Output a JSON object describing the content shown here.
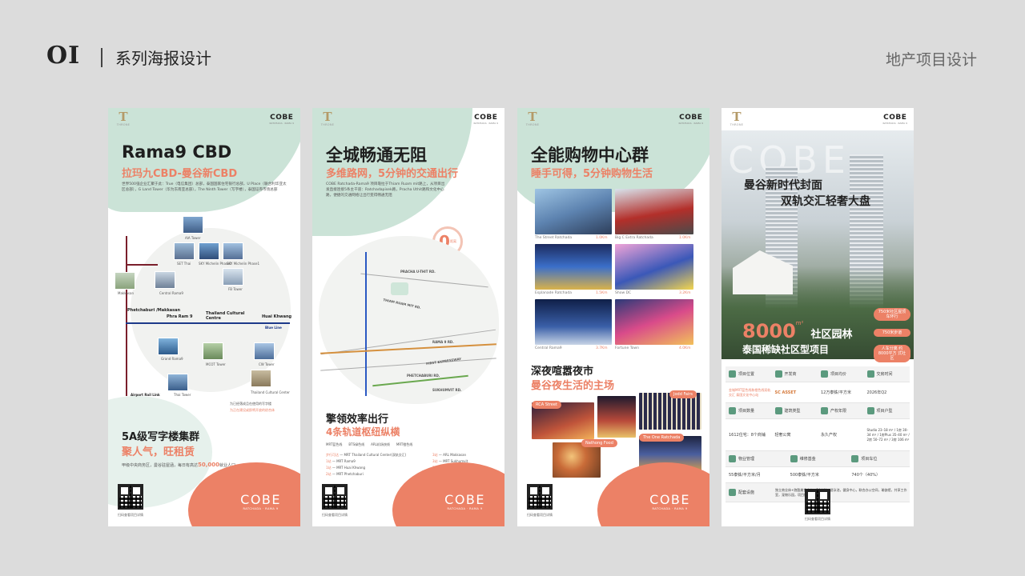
{
  "header": {
    "number": "OI",
    "title": "系列海报设计",
    "right_label": "地产项目设计"
  },
  "brand": {
    "throne": "T",
    "throne_sub": "THRONE",
    "cobe": "COBE",
    "cobe_sub": "RATCHADA · RAMA 9"
  },
  "qr_caption": "扫码查看项目详情",
  "colors": {
    "accent": "#ec8166",
    "mint": "#cbe3d7",
    "background": "#dcdcdc"
  },
  "p1": {
    "title": "Rama9 CBD",
    "subtitle": "拉玛九CBD-曼谷新CBD",
    "desc": "世界500强企业汇聚于此：True（电信集团）总部，泰国国家住宅银行总部，U Place（联合利华亚太区总部），G Land Tower（华为东南亚总部），The Ninth Tower（写字楼），泰国证券市场总部",
    "stations": [
      "Phetchaburi /Makkasan",
      "Phra Ram 9",
      "Thailand Cultural Centre",
      "Huai Khwang"
    ],
    "blue_line": "Blue Line",
    "airport_link": "Airport Rail Link",
    "buildings": [
      "AIA Tower",
      "SET Thai",
      "SKY Michelin Phase2",
      "SKY Michelin Phase1",
      "Makkasan",
      "Central Rama9",
      "G Tower",
      "FB Tower",
      "Grand Rama9",
      "MCOT Tower",
      "CW Tower",
      "Thai Tower",
      "Thailand Cultural Center"
    ],
    "legend": [
      "为已经落成且在使用的写字楼",
      "为正在建设或即将开放的综合体"
    ],
    "section_title": "5A级写字楼集群",
    "section_sub": "聚人气，旺租赁",
    "foot_note_a": "甲级中央商务区，曼谷驻屋涵，每日有高达",
    "foot_note_b": "50,000",
    "foot_note_c": "就业人口"
  },
  "p2": {
    "title": "全城畅通无阻",
    "subtitle": "多维路网，5分钟的交通出行",
    "desc": "COBE Ratchada-Rama9 项目靠拉于Thiam Ruam mit路上，从项目出发直接连接5条主干道：Ratchadapisek路，Pracha Uthit路和文化中心路，便捷的交通网络让出行变得畅通无阻",
    "badge": "0",
    "badge_unit": "距离",
    "roads": [
      "PRACHA U-THIT RD.",
      "THIAM RUAM MIT RD.",
      "RAMA 9 RD.",
      "PHETCHABURI RD.",
      "SUKHUMVIT RD.",
      "FIRST EXPRESSWAY"
    ],
    "section_title": "擎领效率出行",
    "section_sub": "4条轨道枢纽纵横",
    "legend": [
      "MRT蓝色线",
      "BTS绿色线",
      "ARL机场快线",
      "MRT橙色线"
    ],
    "routes_left": [
      [
        "步行可达",
        "MRT Thailand Cultural Center(双轨交汇)"
      ],
      [
        "1站",
        "MRT Rama9"
      ],
      [
        "1站",
        "MRT Huai Khwang"
      ],
      [
        "2站",
        "MRT Phetchaburi"
      ]
    ],
    "routes_right": [
      [
        "3站",
        "ARL Makkasan"
      ],
      [
        "3站",
        "MRT Sukhumvit"
      ],
      [
        "3站",
        "BTS Asok"
      ]
    ]
  },
  "p3": {
    "title": "全能购物中心群",
    "subtitle": "睡手可得，5分钟购物生活",
    "malls": [
      {
        "name": "The Street Ratchada",
        "dist": "1.0Km"
      },
      {
        "name": "Big C Extra Ratchada",
        "dist": "1.0Km"
      },
      {
        "name": "Esplanade Ratchada",
        "dist": "1.5Km"
      },
      {
        "name": "Show DC",
        "dist": "3.2Km"
      },
      {
        "name": "Central Rama9",
        "dist": "3.7Km"
      },
      {
        "name": "Fortune Town",
        "dist": "4.0Km"
      }
    ],
    "section_title": "深夜喧嚣夜市",
    "section_sub": "曼谷夜生活的主场",
    "markets": [
      "RCA Street",
      "Jodd Fairs",
      "Nathong Food",
      "The One Ratchada"
    ]
  },
  "p4": {
    "watermark": "COBE",
    "headline_a": "曼谷新时代封面",
    "headline_b": "双轨交汇轻奢大盘",
    "area_num": "8000",
    "area_unit": "m²",
    "area_label": "社区园林",
    "area_sub": "泰国稀缺社区型项目",
    "badges": [
      "750米社区屋顶车环行",
      "750米步道",
      "人车分离 约8000平方 式社区"
    ],
    "table": {
      "h1": [
        "项目位置",
        "开发商",
        "项目均价",
        "交房时间"
      ],
      "r1": [
        "金城MRT蓝色线和橙色线双轨交汇 泰国文化中心站",
        "SC ASSET",
        "12万泰铢/平方米",
        "2026年Q2"
      ],
      "h2": [
        "项目数量",
        "建筑类型",
        "产权年限",
        "项目户型"
      ],
      "r2": [
        "1612住宅：8个商铺",
        "轻奢公寓",
        "永久产权",
        "Studio 23–18 m² / 1房 30–34 m² / 1房Plus 35–40 m² / 2房 50–72 m² / 3房 106 m²"
      ],
      "h3": [
        "物业管理",
        "维修基金",
        "项目车位"
      ],
      "r3": [
        "55泰铢/平方米/月",
        "500泰铢/平方米",
        "740个（40%）"
      ],
      "facility_label": "配套设施",
      "facility_text": "独立商业体+跑酷美食中心，24小时一游泳池，健身中心，联合办公空间，瑜伽馆，共享工作室，宠物乐园，项目接驳车"
    }
  }
}
